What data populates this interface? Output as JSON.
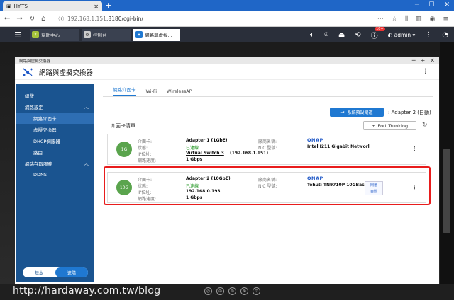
{
  "browser": {
    "tab_title": "HY-TS",
    "url_host": "192.168.1.151",
    "url_rest": ":8180/cgi-bin/"
  },
  "qts": {
    "tabs": [
      {
        "label": "幫助中心"
      },
      {
        "label": "控制台"
      },
      {
        "label": "網路與虛擬..."
      }
    ],
    "user": "admin",
    "notif_badge": "10+"
  },
  "window": {
    "titlebar": "網路與虛擬交換器",
    "title": "網路與虛擬交換器"
  },
  "sidebar": {
    "items": [
      {
        "label": "總覽"
      },
      {
        "label": "網路設定"
      },
      {
        "label": "網路介面卡"
      },
      {
        "label": "虛擬交換器"
      },
      {
        "label": "DHCP伺服器"
      },
      {
        "label": "路由"
      },
      {
        "label": "網路存取服務"
      },
      {
        "label": "DDNS"
      }
    ],
    "mode_basic": "基本",
    "mode_advanced": "進階"
  },
  "main": {
    "subtabs": [
      "網路介面卡",
      "Wi-Fi",
      "WirelessAP"
    ],
    "gateway_button": "系統預設閘道",
    "gateway_value": ": Adapter 2 (自動)",
    "list_title": "介面卡清單",
    "port_trunking": "Port Trunking",
    "labels": {
      "adapter": "介面卡:",
      "status": "狀態:",
      "ip": "IP位址:",
      "speed": "網路速度:",
      "vendor": "廠商名稱:",
      "nic": "NIC 型號:"
    },
    "cards": [
      {
        "adapter": "Adapter 1 (1GbE)",
        "status": "已連線",
        "ip": "Virtual Switch 3",
        "ip_extra": "(192.168.1.151)",
        "speed": "1 Gbps",
        "vendor_logo": "QNAP",
        "nic": "Intel I211 Gigabit Networl",
        "icon_text": "1G"
      },
      {
        "adapter": "Adapter 2 (10GbE)",
        "status": "已連線",
        "ip": "192.168.0.193",
        "speed": "1 Gbps",
        "vendor_logo": "QNAP",
        "nic": "Tehuti TN9710P 10GBase",
        "icon_text": "10G",
        "pill_top": "閘道",
        "pill_bottom": "自動"
      }
    ]
  },
  "watermark": "http://hardaway.com.tw/blog",
  "colors": {
    "accent": "#1f78d1",
    "sidebar": "#1a5490",
    "highlight": "#e81c1c",
    "connected": "#2a9a2a"
  }
}
